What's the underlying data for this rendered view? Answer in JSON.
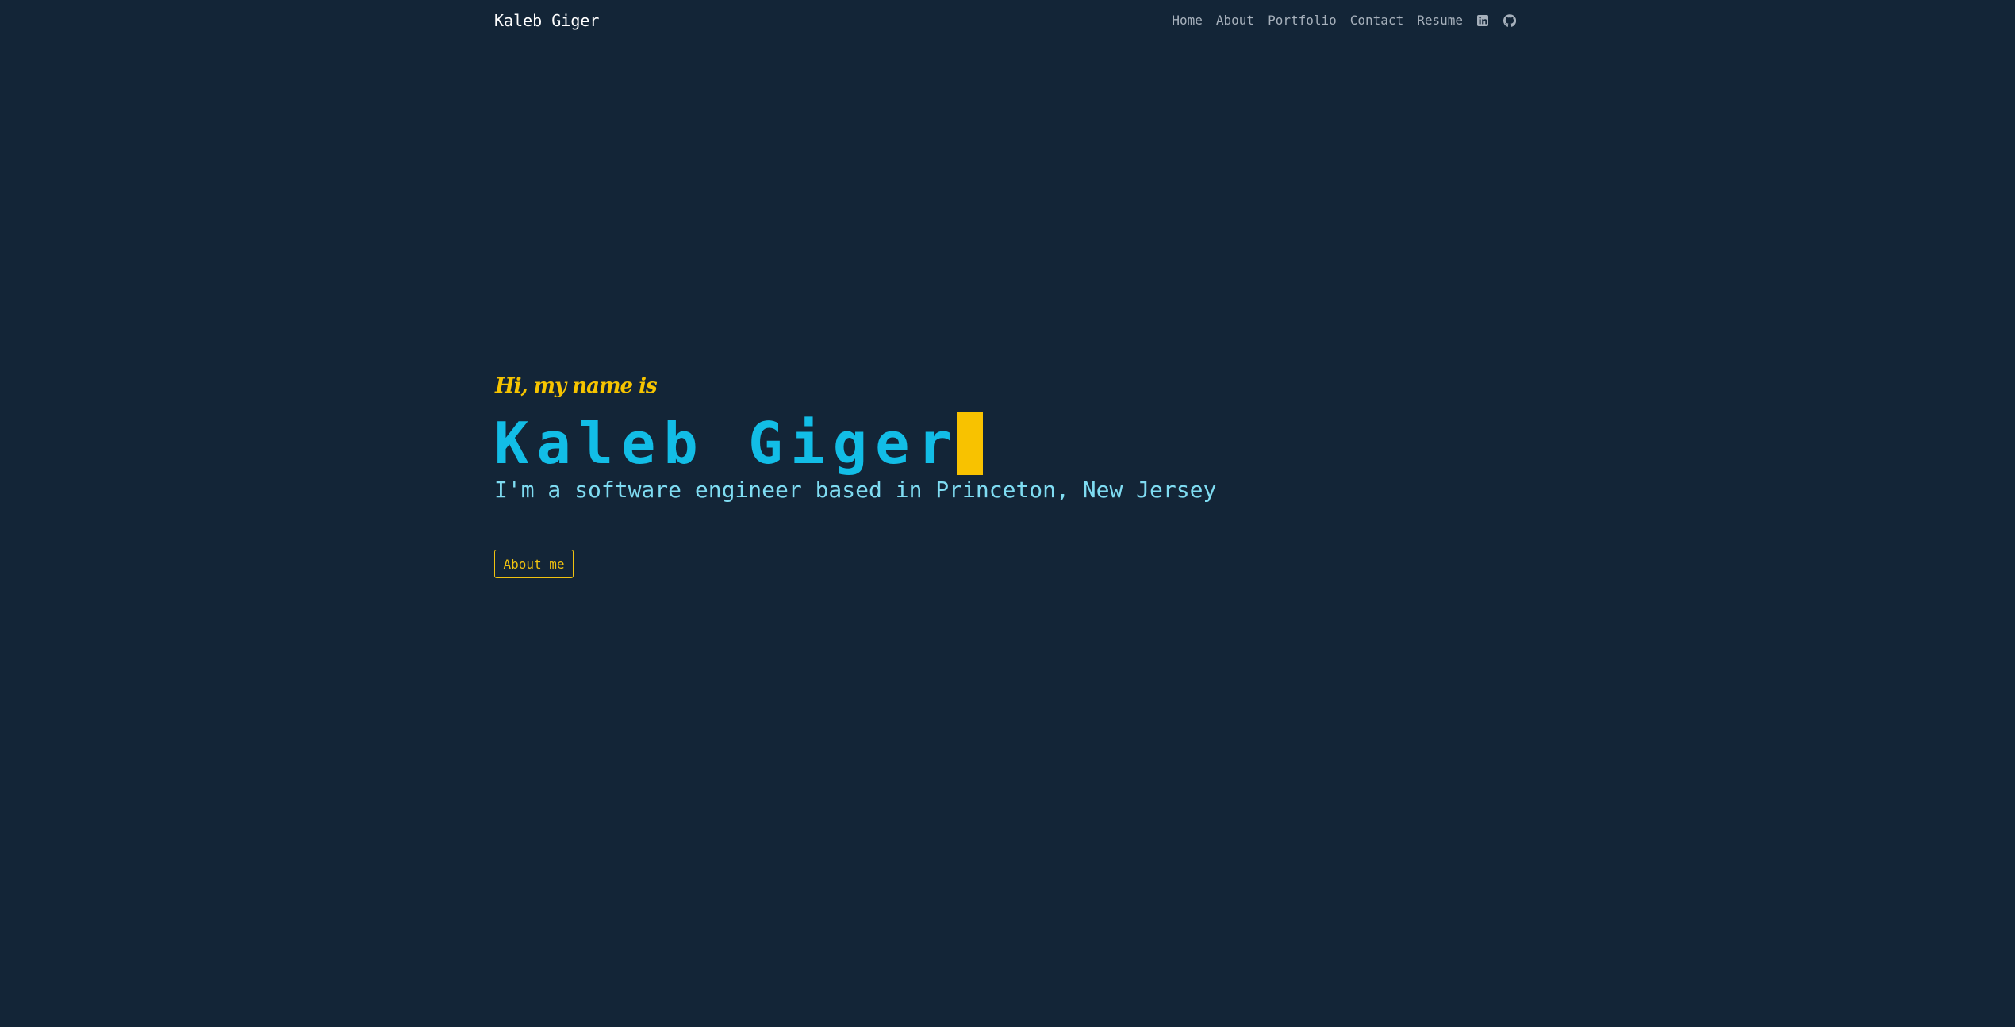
{
  "navbar": {
    "brand": "Kaleb Giger",
    "links": [
      {
        "label": "Home"
      },
      {
        "label": "About"
      },
      {
        "label": "Portfolio"
      },
      {
        "label": "Contact"
      },
      {
        "label": "Resume"
      }
    ],
    "icons": [
      {
        "name": "linkedin-icon"
      },
      {
        "name": "github-icon"
      }
    ]
  },
  "hero": {
    "greeting": "Hi, my name is",
    "name": "Kaleb Giger",
    "tagline": "I'm a software engineer based in Princeton, New Jersey",
    "cta_label": "About me"
  },
  "colors": {
    "background": "#132537",
    "brand_text": "#ffffff",
    "nav_link": "#a6b0bb",
    "accent_yellow": "#f6c400",
    "name_cyan": "#12bde6",
    "tagline_cyan": "#7fdcf2"
  }
}
